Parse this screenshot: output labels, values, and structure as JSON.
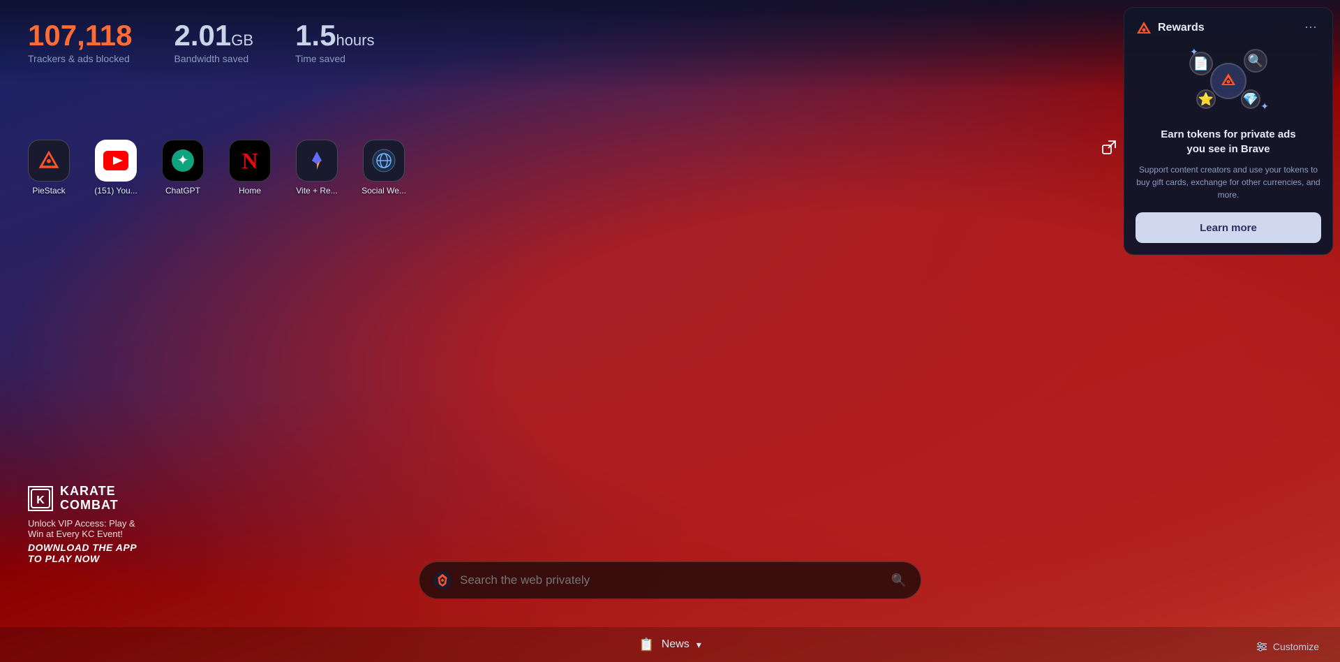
{
  "stats": {
    "trackers": {
      "value": "107,118",
      "label": "Trackers & ads blocked"
    },
    "bandwidth": {
      "value": "2.01",
      "unit": "GB",
      "label": "Bandwidth saved"
    },
    "time": {
      "value": "1.5",
      "unit": "hours",
      "label": "Time saved"
    }
  },
  "shortcuts": [
    {
      "label": "PieStack",
      "icon": "🔺",
      "bg": "dark"
    },
    {
      "label": "(151) You...",
      "icon": "▶",
      "bg": "youtube"
    },
    {
      "label": "ChatGPT",
      "icon": "✦",
      "bg": "dark"
    },
    {
      "label": "Home",
      "icon": "N",
      "bg": "netflix"
    },
    {
      "label": "Vite + Re...",
      "icon": "⚡",
      "bg": "dark"
    },
    {
      "label": "Social We...",
      "icon": "🌐",
      "bg": "dark"
    }
  ],
  "search": {
    "placeholder": "Search the web privately"
  },
  "news": {
    "label": "News"
  },
  "customize": {
    "label": "Customize"
  },
  "rewards": {
    "title": "Rewards",
    "body_title": "Earn tokens for private ads\nyou see in Brave",
    "body_desc": "Support content creators and use your tokens to buy gift cards, exchange for other currencies, and more.",
    "learn_more": "Learn more"
  },
  "kc_branding": {
    "name": "KARATE\nCOMBAT",
    "subtitle": "Unlock VIP Access: Play &\nWin at Every KC Event!",
    "cta": "DOWNLOAD THE APP\nTO PLAY NOW"
  }
}
